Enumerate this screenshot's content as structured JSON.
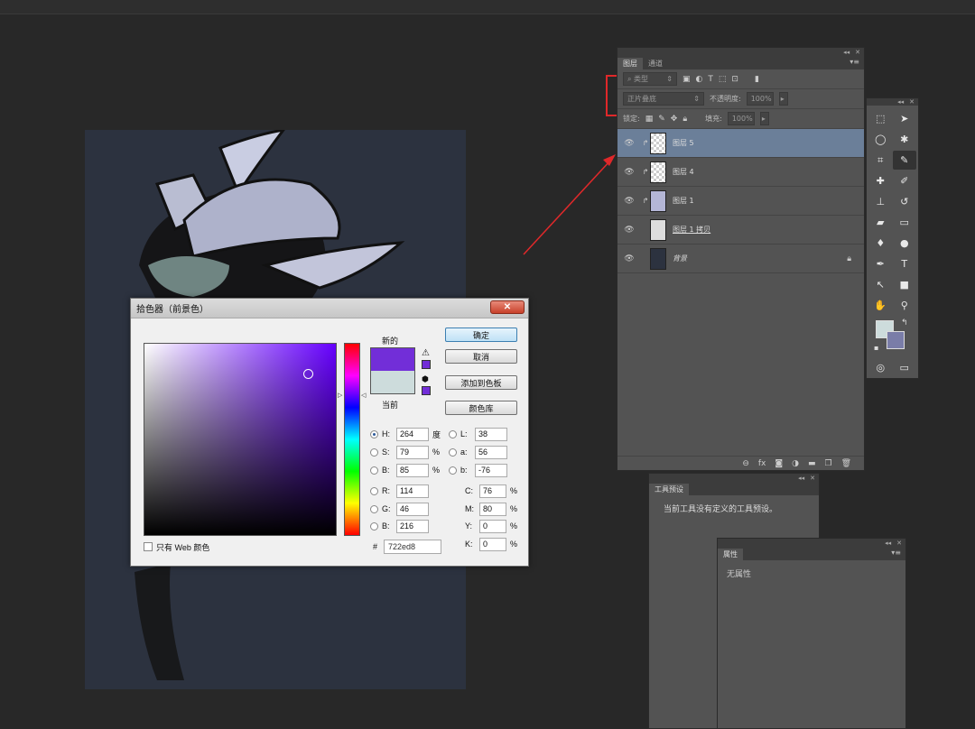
{
  "layers_panel": {
    "tabs": [
      "图层",
      "通道"
    ],
    "filter_kind": "类型",
    "blend_mode": "正片叠底",
    "opacity_label": "不透明度:",
    "opacity_value": "100%",
    "lock_label": "锁定:",
    "fill_label": "填充:",
    "fill_value": "100%",
    "layers": [
      {
        "name": "图层 5",
        "selected": true,
        "clipped": true
      },
      {
        "name": "图层 4",
        "selected": false,
        "clipped": true
      },
      {
        "name": "图层 1",
        "selected": false,
        "clipped": true
      },
      {
        "name": "图层 1 拷贝",
        "selected": false,
        "clipped": false
      },
      {
        "name": "背景",
        "selected": false,
        "clipped": false,
        "locked": true
      }
    ]
  },
  "tool_presets": {
    "title": "工具预设",
    "message": "当前工具没有定义的工具预设。"
  },
  "properties": {
    "title": "属性",
    "message": "无属性"
  },
  "color_picker": {
    "title": "拾色器（前景色）",
    "close_label": "✕",
    "new_label": "新的",
    "current_label": "当前",
    "new_color": "#722ed8",
    "current_color": "#cddcdc",
    "buttons": {
      "ok": "确定",
      "cancel": "取消",
      "add_swatch": "添加到色板",
      "libraries": "颜色库"
    },
    "fields": {
      "h": {
        "label": "H:",
        "value": "264",
        "unit": "度"
      },
      "s": {
        "label": "S:",
        "value": "79",
        "unit": "%"
      },
      "b": {
        "label": "B:",
        "value": "85",
        "unit": "%"
      },
      "r": {
        "label": "R:",
        "value": "114"
      },
      "g": {
        "label": "G:",
        "value": "46"
      },
      "bl": {
        "label": "B:",
        "value": "216"
      },
      "l": {
        "label": "L:",
        "value": "38"
      },
      "a": {
        "label": "a:",
        "value": "56"
      },
      "b2": {
        "label": "b:",
        "value": "-76"
      },
      "c": {
        "label": "C:",
        "value": "76",
        "unit": "%"
      },
      "m": {
        "label": "M:",
        "value": "80",
        "unit": "%"
      },
      "y": {
        "label": "Y:",
        "value": "0",
        "unit": "%"
      },
      "k": {
        "label": "K:",
        "value": "0",
        "unit": "%"
      }
    },
    "hex_label": "#",
    "hex_value": "722ed8",
    "web_only_label": "只有 Web 颜色"
  },
  "colors": {
    "annotation": "#e0282a",
    "selected_layer": "#6b7f99",
    "foreground": "#cddcdc",
    "background": "#7a7da8"
  }
}
